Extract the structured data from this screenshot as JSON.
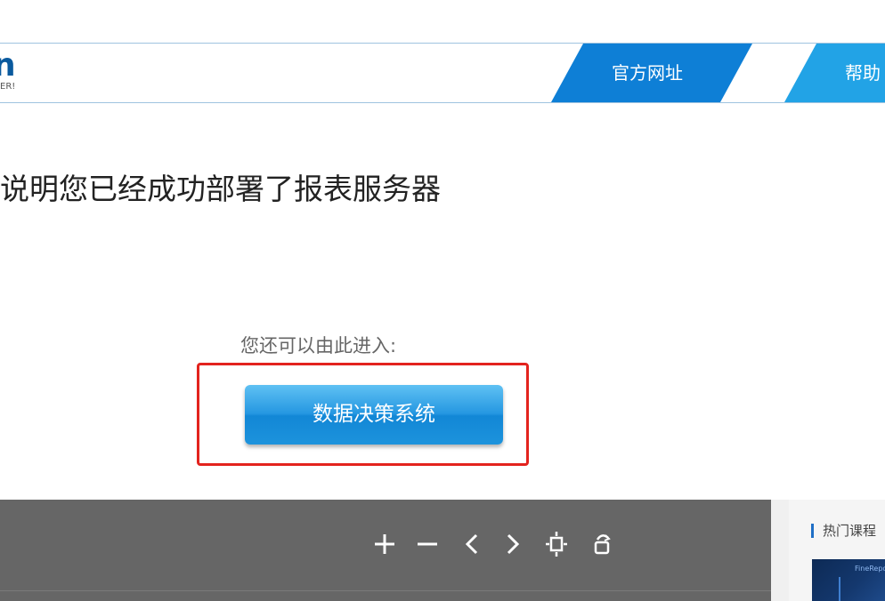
{
  "header": {
    "logo_text": "n",
    "logo_subtext": "ER!",
    "nav": [
      {
        "label": "官方网址"
      },
      {
        "label": "帮助"
      }
    ]
  },
  "main": {
    "message": "说明您已经成功部署了报表服务器",
    "enter_hint": "您还可以由此进入:",
    "decision_button": "数据决策系统"
  },
  "viewer": {
    "toolbar": [
      {
        "icon": "zoom-in-icon"
      },
      {
        "icon": "zoom-out-icon"
      },
      {
        "icon": "previous-icon"
      },
      {
        "icon": "next-icon"
      },
      {
        "icon": "fit-screen-icon"
      },
      {
        "icon": "rotate-icon"
      }
    ]
  },
  "side_panel": {
    "title": "热门课程",
    "thumbnail_label": "FineRepo"
  },
  "colors": {
    "nav_tab_primary": "#0e7fd6",
    "nav_tab_secondary": "#22a3e6",
    "highlight_border": "#e3231e",
    "button_blue": "#1d93dc",
    "viewer_bg": "#666666"
  }
}
